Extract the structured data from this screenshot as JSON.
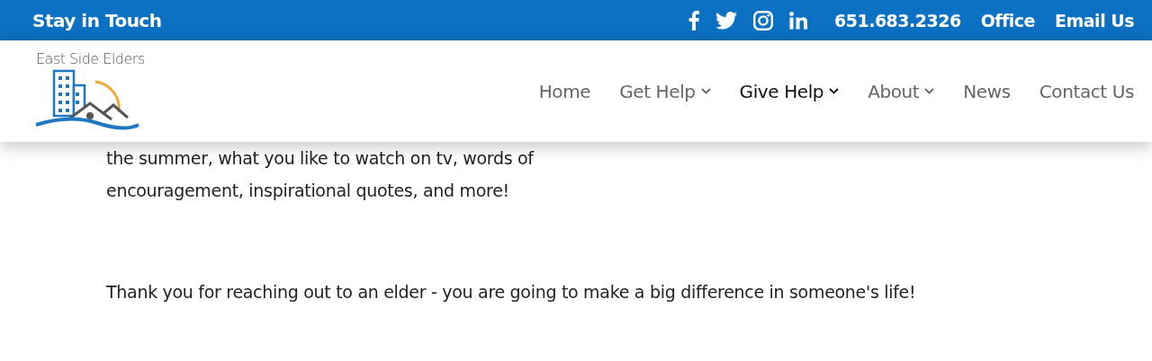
{
  "top_bar": {
    "title": "Stay in Touch",
    "social": [
      {
        "kind": "facebook"
      },
      {
        "kind": "twitter"
      },
      {
        "kind": "instagram"
      },
      {
        "kind": "linkedin"
      }
    ],
    "links": [
      "651.683.2326",
      "Office",
      "Email Us"
    ]
  },
  "header": {
    "logo_text": "East Side Elders",
    "nav": [
      {
        "label": "Home",
        "selected": false,
        "has_dropdown": false
      },
      {
        "label": "Get Help",
        "selected": false,
        "has_dropdown": true
      },
      {
        "label": "Give Help",
        "selected": true,
        "has_dropdown": true
      },
      {
        "label": "About",
        "selected": false,
        "has_dropdown": true
      },
      {
        "label": "News",
        "selected": false,
        "has_dropdown": false
      },
      {
        "label": "Contact Us",
        "selected": false,
        "has_dropdown": false
      }
    ]
  },
  "content": {
    "paragraphs": [
      {
        "lines": [
          "the summer, what you like to watch on tv, words of",
          "encouragement, inspirational quotes, and more!"
        ]
      },
      {
        "lines": [
          "Thank you for reaching out to an elder - you are going to make a big difference in someone's life!"
        ]
      }
    ]
  }
}
